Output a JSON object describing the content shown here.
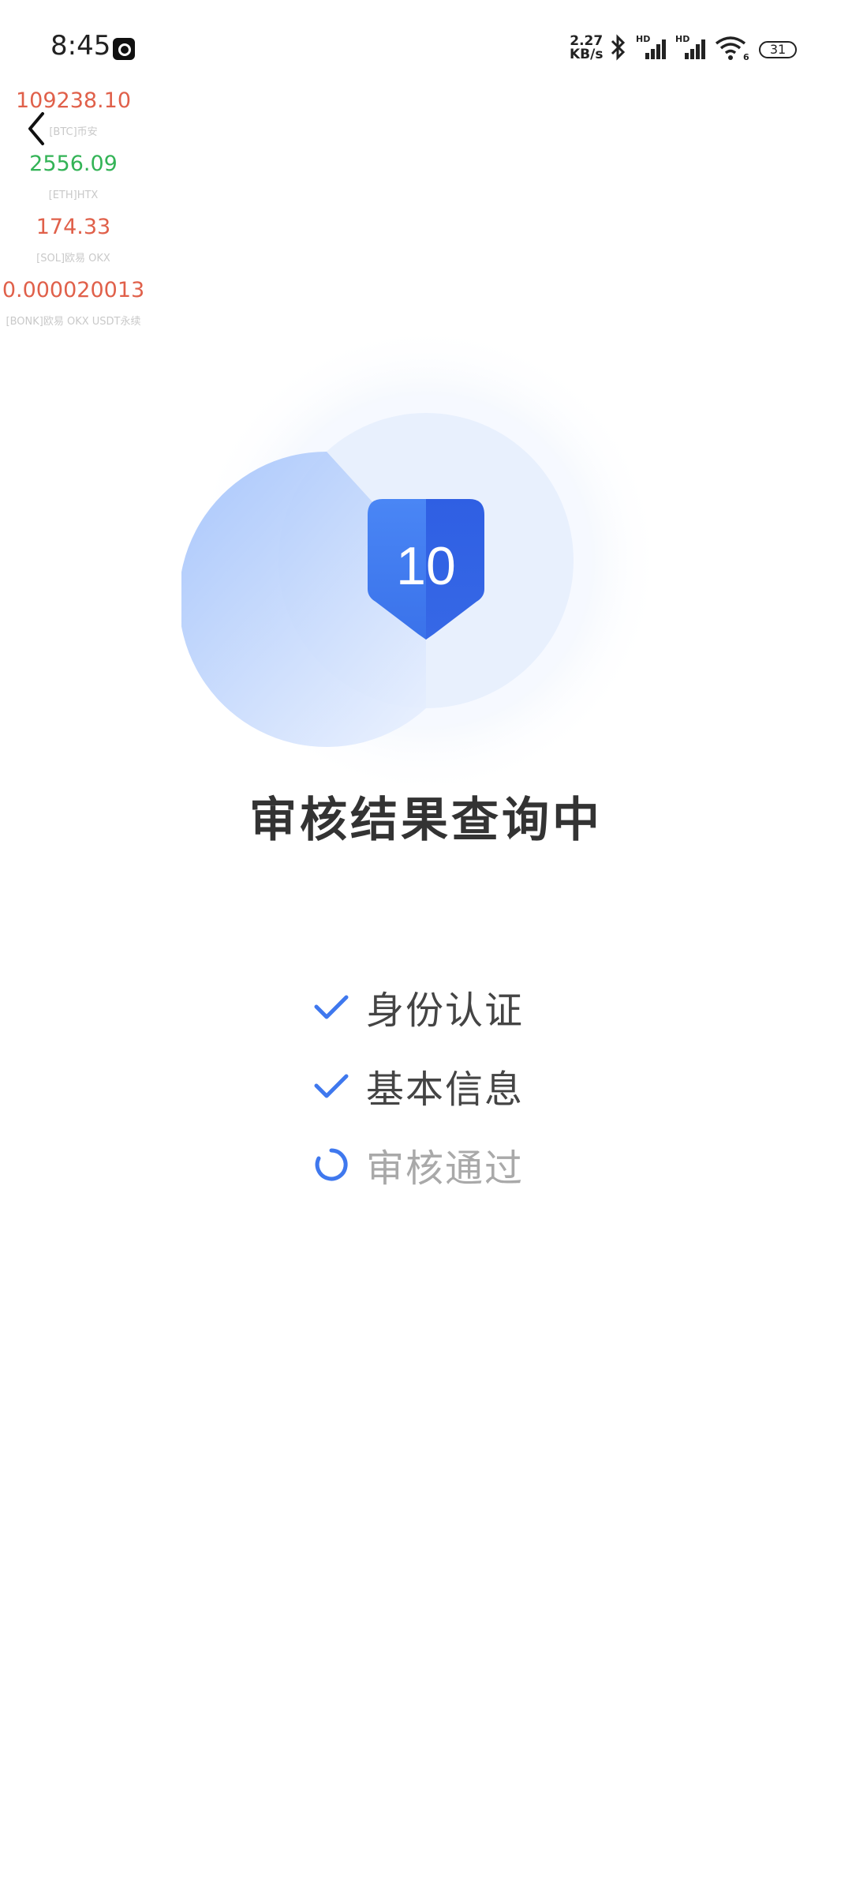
{
  "status_bar": {
    "time": "8:45",
    "net_speed_value": "2.27",
    "net_speed_unit": "KB/s",
    "sim1_label": "HD",
    "sim2_label": "HD",
    "wifi_badge": "6",
    "battery": "31"
  },
  "ticker": [
    {
      "price": "109238.10",
      "label": "[BTC]币安",
      "color": "red"
    },
    {
      "price": "2556.09",
      "label": "[ETH]HTX",
      "color": "green"
    },
    {
      "price": "174.33",
      "label": "[SOL]欧易 OKX",
      "color": "red"
    },
    {
      "price": "0.000020013",
      "label": "[BONK]欧易 OKX USDT永续",
      "color": "red"
    }
  ],
  "emblem": {
    "countdown": "10"
  },
  "title": "审核结果查询中",
  "steps": [
    {
      "label": "身份认证",
      "state": "done"
    },
    {
      "label": "基本信息",
      "state": "done"
    },
    {
      "label": "审核通过",
      "state": "loading"
    }
  ],
  "colors": {
    "accent": "#3f78ee",
    "price_up": "#e0604a",
    "price_down": "#33b356"
  }
}
